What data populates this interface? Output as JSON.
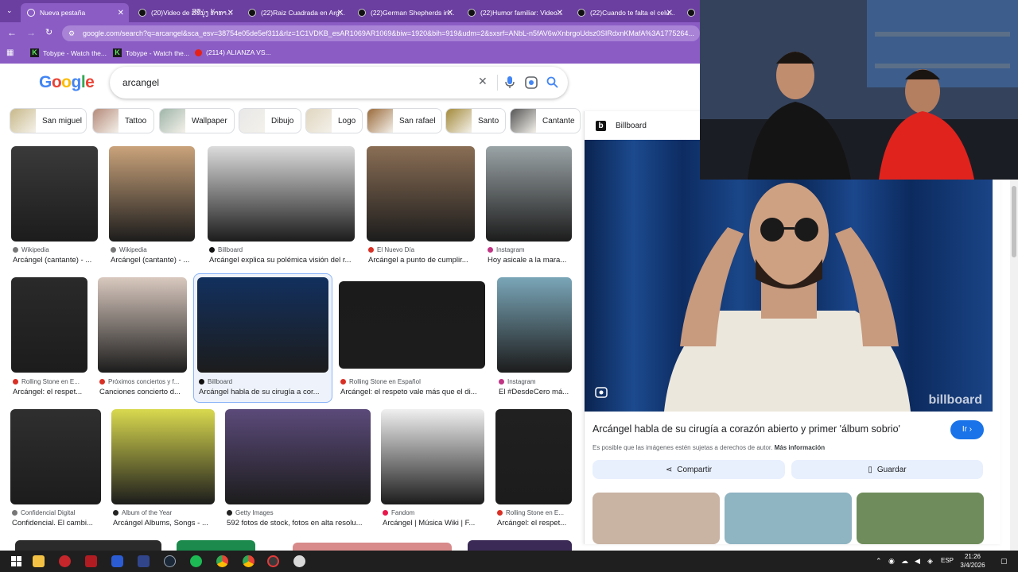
{
  "browser": {
    "tabs": [
      {
        "label": "Nueva pestaña"
      },
      {
        "label": "(20)Video de ສີທີ່ນຸ່ງ ທ້າທາ..."
      },
      {
        "label": "(22)Raiz Cuadrada en Arg..."
      },
      {
        "label": "(22)German Shepherds in..."
      },
      {
        "label": "(22)Humor familiar: Video..."
      },
      {
        "label": "(22)Cuando te falta el celu..."
      }
    ],
    "url": "google.com/search?q=arcangel&sca_esv=38754e05de5ef311&rlz=1C1VDKB_esAR1069AR1069&biw=1920&bih=919&udm=2&sxsrf=ANbL-n5fAV6wXnbrgoUdsz0SIRdxnKMafA%3A1775264...",
    "bookmarks": [
      {
        "label": "Tobype - Watch the..."
      },
      {
        "label": "Tobype - Watch the..."
      },
      {
        "label": "(2114) ALIANZA VS..."
      }
    ]
  },
  "google": {
    "logo": "Google",
    "query": "arcangel"
  },
  "chips": [
    {
      "label": "San miguel",
      "color": "#c8b98a"
    },
    {
      "label": "Tattoo",
      "color": "#b58a7a"
    },
    {
      "label": "Wallpaper",
      "color": "#9fb5a8"
    },
    {
      "label": "Dibujo",
      "color": "#e8e8e8"
    },
    {
      "label": "Logo",
      "color": "#e0d6c0"
    },
    {
      "label": "San rafael",
      "color": "#9a6a3a"
    },
    {
      "label": "Santo",
      "color": "#a38a3a"
    },
    {
      "label": "Cantante",
      "color": "#555555"
    }
  ],
  "results": [
    {
      "source": "Wikipedia",
      "title": "Arcángel (cantante) - ...",
      "color": "#3a3a3a",
      "dot": "#777777"
    },
    {
      "source": "Wikipedia",
      "title": "Arcángel (cantante) - ...",
      "color": "#caa37b",
      "dot": "#777777"
    },
    {
      "source": "Billboard",
      "title": "Arcángel explica su polémica visión del r...",
      "color": "#dcdcdc",
      "dot": "#111111"
    },
    {
      "source": "El Nuevo Día",
      "title": "Arcángel a punto de cumplir...",
      "color": "#8a6e55",
      "dot": "#d93025"
    },
    {
      "source": "Instagram",
      "title": "Hoy asicale a la mara...",
      "color": "#9aa3a6",
      "dot": "#c13584"
    },
    {
      "source": "Rolling Stone en E...",
      "title": "Arcángel: el respet...",
      "color": "#2a2a2a",
      "dot": "#d93025"
    },
    {
      "source": "Próximos conciertos y f...",
      "title": "Canciones concierto d...",
      "color": "#d9c9bf",
      "dot": "#d93025"
    },
    {
      "source": "Billboard",
      "title": "Arcángel habla de su cirugía a cor...",
      "color": "#12305e",
      "dot": "#111111"
    },
    {
      "source": "Rolling Stone en Español",
      "title": "Arcángel: el respeto vale más que el di...",
      "color": "#1b1b1b",
      "dot": "#d93025"
    },
    {
      "source": "Instagram",
      "title": "El #DesdeCero má...",
      "color": "#7aa6b8",
      "dot": "#c13584"
    },
    {
      "source": "Confidencial Digital",
      "title": "Confidencial. El cambi...",
      "color": "#2f2f2f",
      "dot": "#777777"
    },
    {
      "source": "Album of the Year",
      "title": "Arcángel Albums, Songs - ...",
      "color": "#d9d94f",
      "dot": "#222222"
    },
    {
      "source": "Getty Images",
      "title": "592 fotos de stock, fotos en alta resolu...",
      "color": "#5b4a7a",
      "dot": "#222222"
    },
    {
      "source": "Fandom",
      "title": "Arcángel | Música Wiki | F...",
      "color": "#f0f0f0",
      "dot": "#e8174b"
    },
    {
      "source": "Rolling Stone en E...",
      "title": "Arcángel: el respet...",
      "color": "#202020",
      "dot": "#d93025"
    }
  ],
  "panel": {
    "source": "Billboard",
    "title": "Arcángel habla de su cirugía a corazón abierto y primer 'álbum sobrio'",
    "button_go": "Ir",
    "note": "Es posible que las imágenes estén sujetas a derechos de autor.",
    "note_link": "Más información",
    "share": "Compartir",
    "save": "Guardar",
    "watermark": "billboard",
    "watermark_small": "billboard"
  },
  "taskbar": {
    "time": "21:26",
    "date": "3/4/2026",
    "lang": "ESP"
  }
}
